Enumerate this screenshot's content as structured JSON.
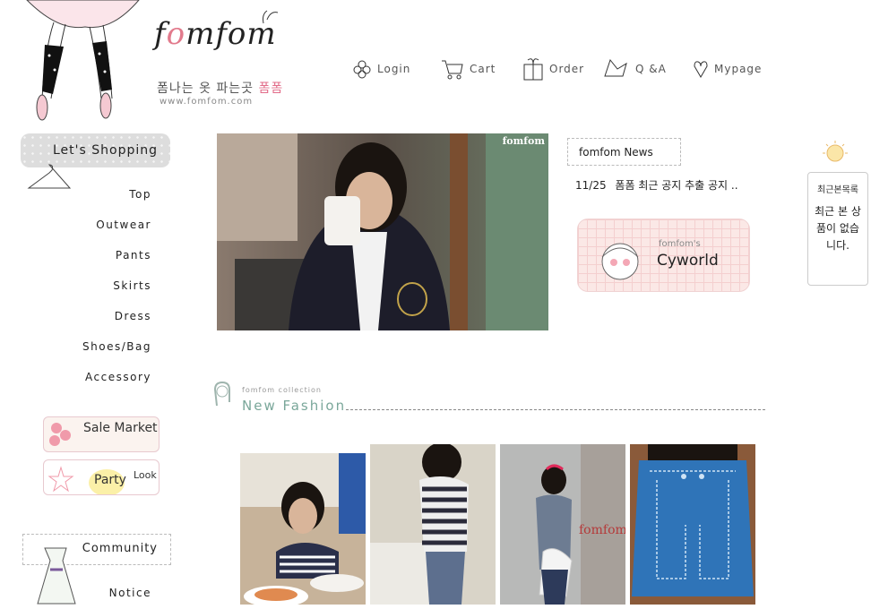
{
  "logo": {
    "brand_prefix": "f",
    "brand_o": "o",
    "brand_rest": "mfom",
    "tagline_main": "폼나는 옷 파는곳 ",
    "tagline_pink": "폼폼",
    "url": "www.fomfom.com"
  },
  "topnav": [
    {
      "label": "Login",
      "icon": "flower-icon"
    },
    {
      "label": "Cart",
      "icon": "cart-icon"
    },
    {
      "label": "Order",
      "icon": "gift-icon"
    },
    {
      "label": "Q &A",
      "icon": "leaf-icon"
    },
    {
      "label": "Mypage",
      "icon": "heart-icon"
    }
  ],
  "sidebar": {
    "shopping_label": "Let's Shopping",
    "items": [
      "Top",
      "Outwear",
      "Pants",
      "Skirts",
      "Dress",
      "Shoes/Bag",
      "Accessory"
    ],
    "sale_market": "Sale Market",
    "party_look_1": "Party",
    "party_look_2": "Look",
    "community": "Community",
    "notice": "Notice"
  },
  "main_photo": {
    "tag": "fomfom"
  },
  "news": {
    "title": "fomfom News",
    "items": [
      {
        "date": "11/25",
        "text": "폼폼 최근 공지 추출 공지 .."
      }
    ]
  },
  "cyworld": {
    "small": "fomfom's",
    "big": "Cyworld"
  },
  "recent": {
    "title": "최근본목록",
    "body": "최근 본 상품이 없습니다."
  },
  "new_fashion": {
    "small": "fomfom collection",
    "title": "New Fashion"
  },
  "products": [
    {
      "tag": ""
    },
    {
      "tag": ""
    },
    {
      "tag": "fomfom"
    },
    {
      "tag": ""
    }
  ],
  "colors": {
    "accent_pink": "#e27a8c",
    "mint": "#7aa79a",
    "badge_gray": "#dddddd"
  }
}
